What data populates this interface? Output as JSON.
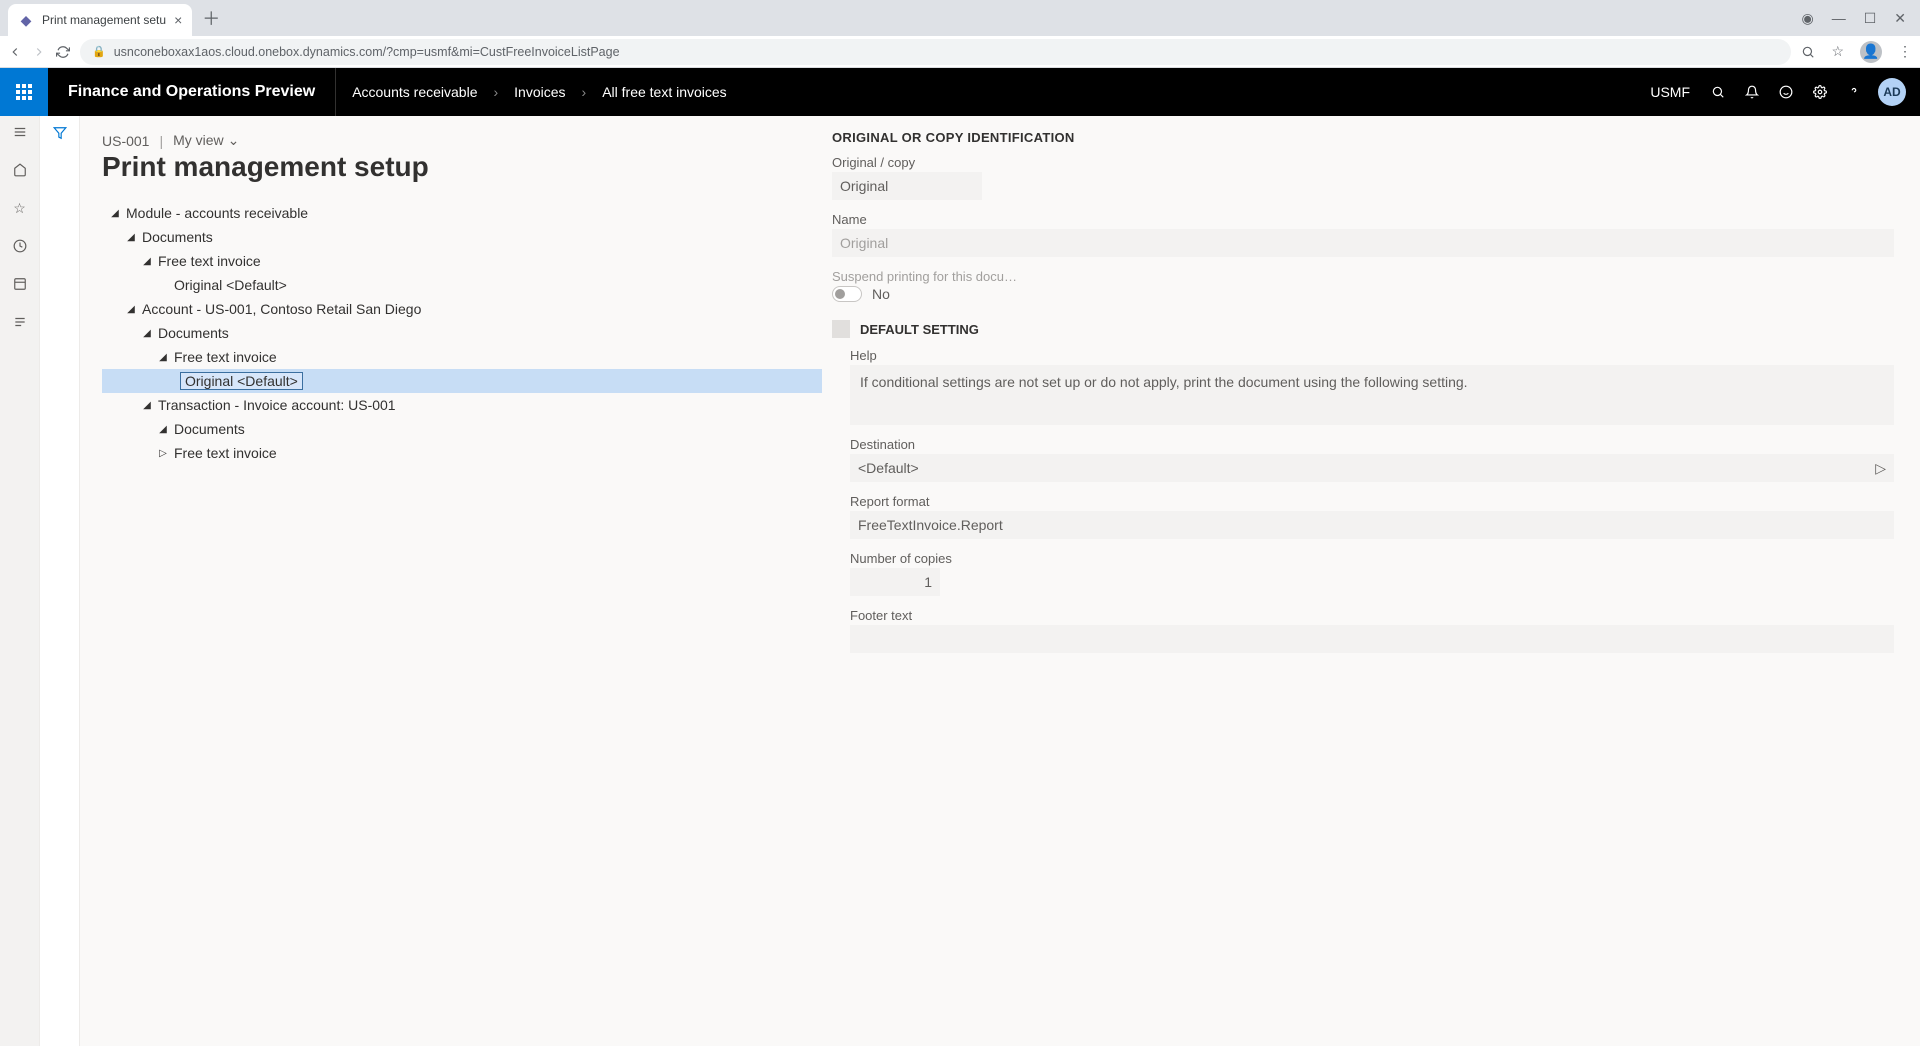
{
  "browser": {
    "tab_title": "Print management setu",
    "url": "usnconeboxax1aos.cloud.onebox.dynamics.com/?cmp=usmf&mi=CustFreeInvoiceListPage"
  },
  "header": {
    "app_title": "Finance and Operations Preview",
    "breadcrumb": [
      "Accounts receivable",
      "Invoices",
      "All free text invoices"
    ],
    "company": "USMF",
    "user_initials": "AD"
  },
  "page": {
    "record_id": "US-001",
    "view_label": "My view",
    "title": "Print management setup"
  },
  "tree": {
    "n0": "Module - accounts receivable",
    "n1": "Documents",
    "n2": "Free text invoice",
    "n3": "Original <Default>",
    "n4": "Account - US-001, Contoso Retail San Diego",
    "n5": "Documents",
    "n6": "Free text invoice",
    "n7": "Original <Default>",
    "n8": "Transaction - Invoice account: US-001",
    "n9": "Documents",
    "n10": "Free text invoice"
  },
  "panel": {
    "section1_title": "ORIGINAL OR COPY IDENTIFICATION",
    "original_copy_label": "Original / copy",
    "original_copy_value": "Original",
    "name_label": "Name",
    "name_value": "Original",
    "suspend_label": "Suspend printing for this docu…",
    "suspend_value": "No",
    "default_setting_label": "DEFAULT SETTING",
    "help_label": "Help",
    "help_text": "If conditional settings are not set up or do not apply, print the document using the following setting.",
    "destination_label": "Destination",
    "destination_value": "<Default>",
    "report_format_label": "Report format",
    "report_format_value": "FreeTextInvoice.Report",
    "copies_label": "Number of copies",
    "copies_value": "1",
    "footer_label": "Footer text",
    "footer_value": ""
  }
}
